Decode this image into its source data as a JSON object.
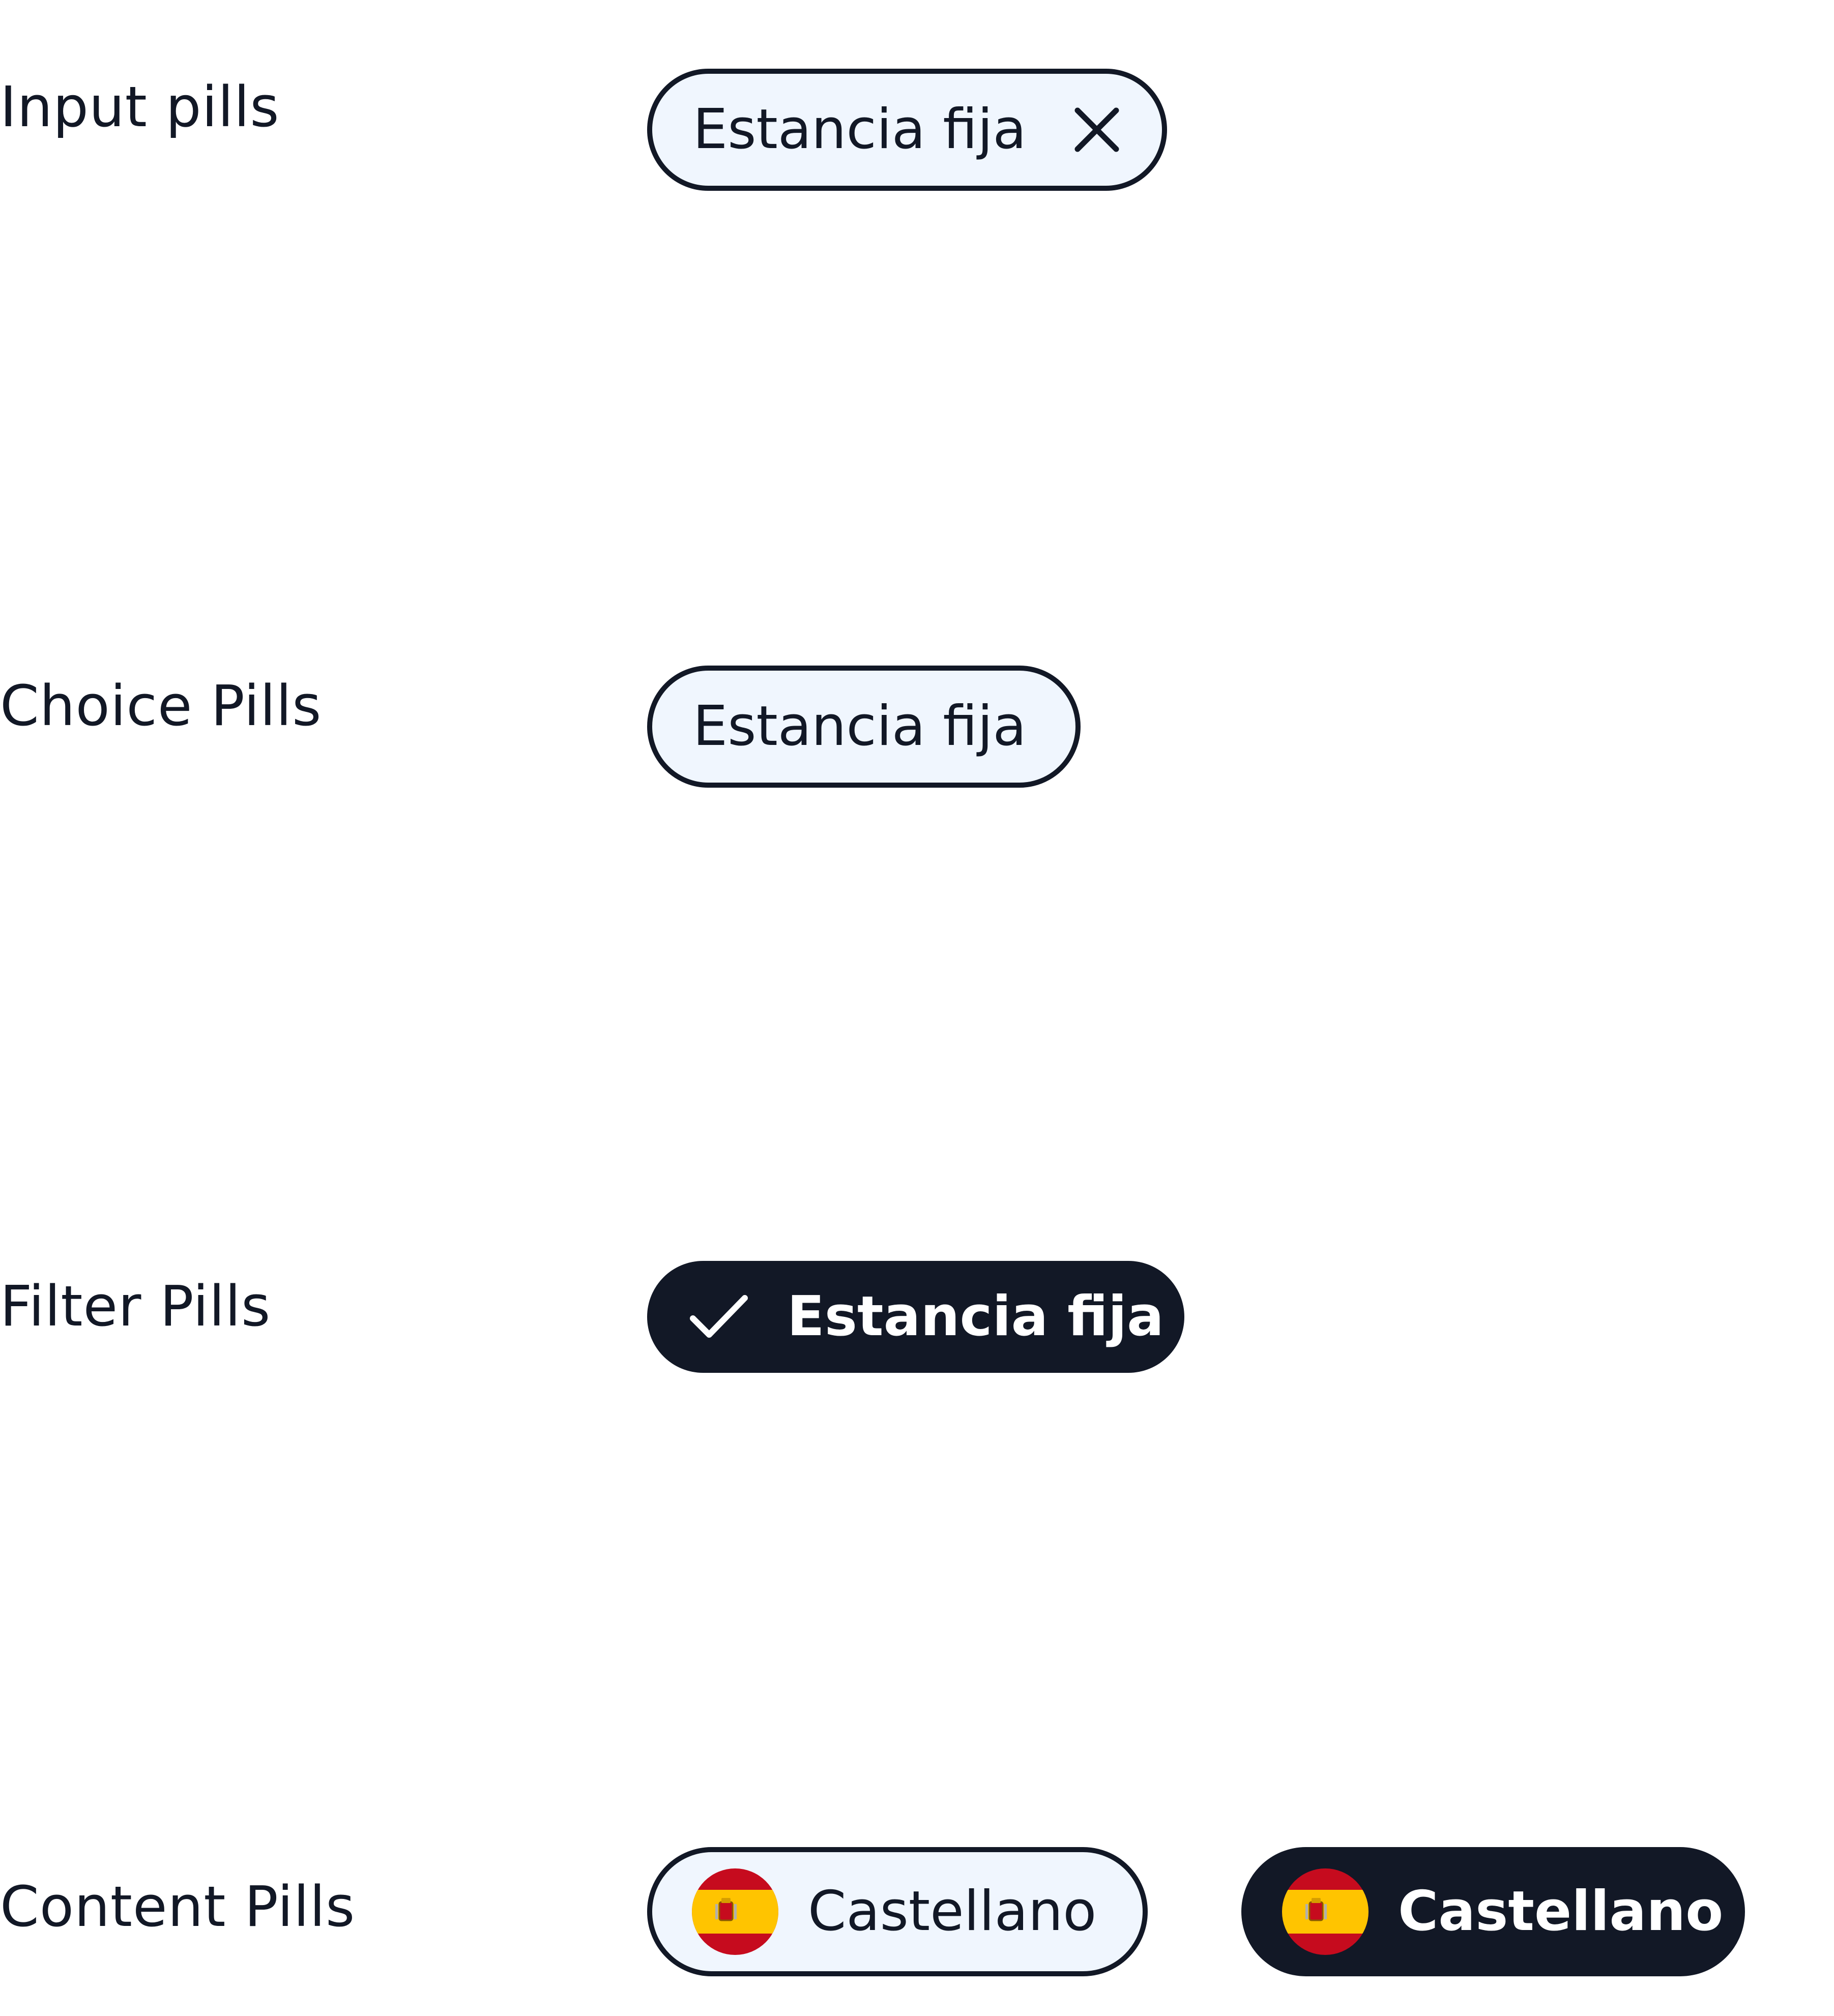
{
  "rows": {
    "input": {
      "label": "Input pills",
      "pill": {
        "text": "Estancia fija",
        "icon": "close-icon"
      }
    },
    "choice": {
      "label": "Choice Pills",
      "pill": {
        "text": "Estancia fija"
      }
    },
    "filter": {
      "label": "Filter Pills",
      "pill": {
        "text": "Estancia fija",
        "icon": "checkmark-icon",
        "selected": true
      }
    },
    "content": {
      "label": "Content Pills",
      "pills": [
        {
          "text": "Castellano",
          "icon": "spain-flag-icon",
          "style": "outline"
        },
        {
          "text": "Castellano",
          "icon": "spain-flag-icon",
          "style": "filled"
        }
      ]
    }
  },
  "colors": {
    "ink": "#121826",
    "pill_fill": "#f0f6fe",
    "background": "#ffffff",
    "flag_red": "#c60b1e",
    "flag_yellow": "#ffc400"
  }
}
